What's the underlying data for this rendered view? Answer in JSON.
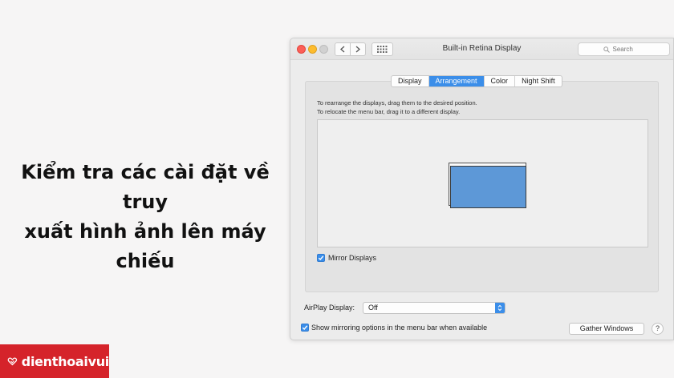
{
  "headline": {
    "line1": "Kiểm tra các cài đặt về truy",
    "line2": "xuất hình ảnh lên máy chiếu"
  },
  "logo": {
    "text": "dienthoaivui"
  },
  "window": {
    "title": "Built-in Retina Display",
    "search_placeholder": "Search"
  },
  "tabs": [
    {
      "label": "Display",
      "active": false
    },
    {
      "label": "Arrangement",
      "active": true
    },
    {
      "label": "Color",
      "active": false
    },
    {
      "label": "Night Shift",
      "active": false
    }
  ],
  "arrangement": {
    "instruction1": "To rearrange the displays, drag them to the desired position.",
    "instruction2": "To relocate the menu bar, drag it to a different display.",
    "mirror_label": "Mirror Displays",
    "mirror_checked": true
  },
  "airplay": {
    "label": "AirPlay Display:",
    "value": "Off"
  },
  "footer": {
    "show_mirroring_label": "Show mirroring options in the menu bar when available",
    "show_mirroring_checked": true,
    "gather_label": "Gather Windows",
    "help_label": "?"
  },
  "colors": {
    "accent": "#3b8ee9",
    "brand": "#d5232a",
    "display": "#5d98d7"
  }
}
